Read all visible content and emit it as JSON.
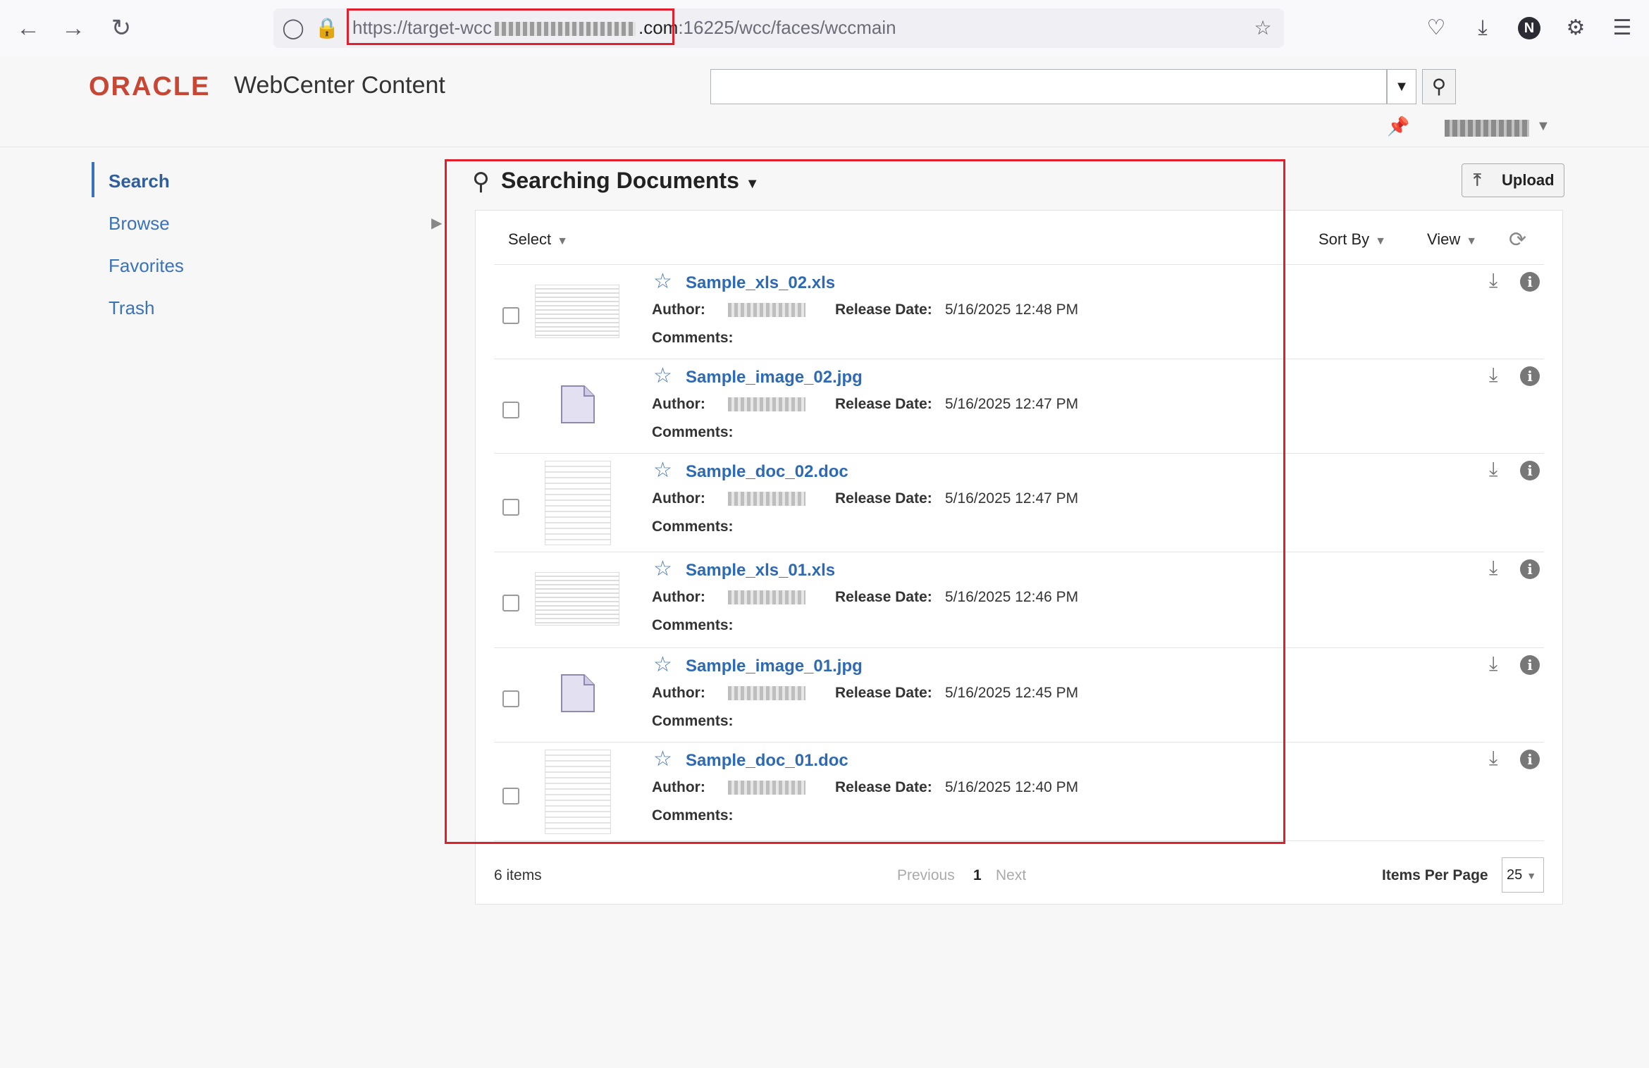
{
  "browser": {
    "url_prefix": "https://target-wcc",
    "url_host_end": ".com",
    "url_rest": ":16225/wcc/faces/wccmain",
    "profile_initial": "N"
  },
  "header": {
    "brand": "ORACLE",
    "product": "WebCenter Content",
    "search_placeholder": ""
  },
  "nav": {
    "items": [
      {
        "label": "Search",
        "active": true
      },
      {
        "label": "Browse",
        "active": false
      },
      {
        "label": "Favorites",
        "active": false
      },
      {
        "label": "Trash",
        "active": false
      }
    ]
  },
  "main": {
    "title": "Searching Documents",
    "upload_label": "Upload",
    "toolbar": {
      "select": "Select",
      "sort_by": "Sort By",
      "view": "View"
    },
    "field_labels": {
      "author": "Author:",
      "release_date": "Release Date:",
      "comments": "Comments:"
    },
    "documents": [
      {
        "name": "Sample_xls_02.xls",
        "release_date": "5/16/2025 12:48 PM",
        "thumb": "sheet"
      },
      {
        "name": "Sample_image_02.jpg",
        "release_date": "5/16/2025 12:47 PM",
        "thumb": "img"
      },
      {
        "name": "Sample_doc_02.doc",
        "release_date": "5/16/2025 12:47 PM",
        "thumb": "doc"
      },
      {
        "name": "Sample_xls_01.xls",
        "release_date": "5/16/2025 12:46 PM",
        "thumb": "sheet"
      },
      {
        "name": "Sample_image_01.jpg",
        "release_date": "5/16/2025 12:45 PM",
        "thumb": "img"
      },
      {
        "name": "Sample_doc_01.doc",
        "release_date": "5/16/2025 12:40 PM",
        "thumb": "doc"
      }
    ],
    "footer": {
      "count": "6 items",
      "previous": "Previous",
      "page": "1",
      "next": "Next",
      "items_per_page_label": "Items Per Page",
      "items_per_page": "25"
    }
  },
  "colors": {
    "accent": "#3b73b9",
    "brand": "#c74634",
    "highlight": "#e0202c"
  }
}
